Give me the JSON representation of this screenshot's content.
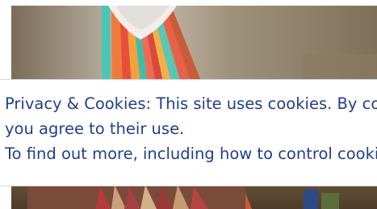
{
  "cookie_notice": {
    "line1": "Privacy & Cookies: This site uses cookies. By continuing to use this website,",
    "line2": "you agree to their use.",
    "line3": "To find out more, including how to control cookies, see here: Cookie Policy"
  },
  "colors": {
    "notice_text": "#1f3f8f",
    "notice_background": "#ffffff"
  }
}
